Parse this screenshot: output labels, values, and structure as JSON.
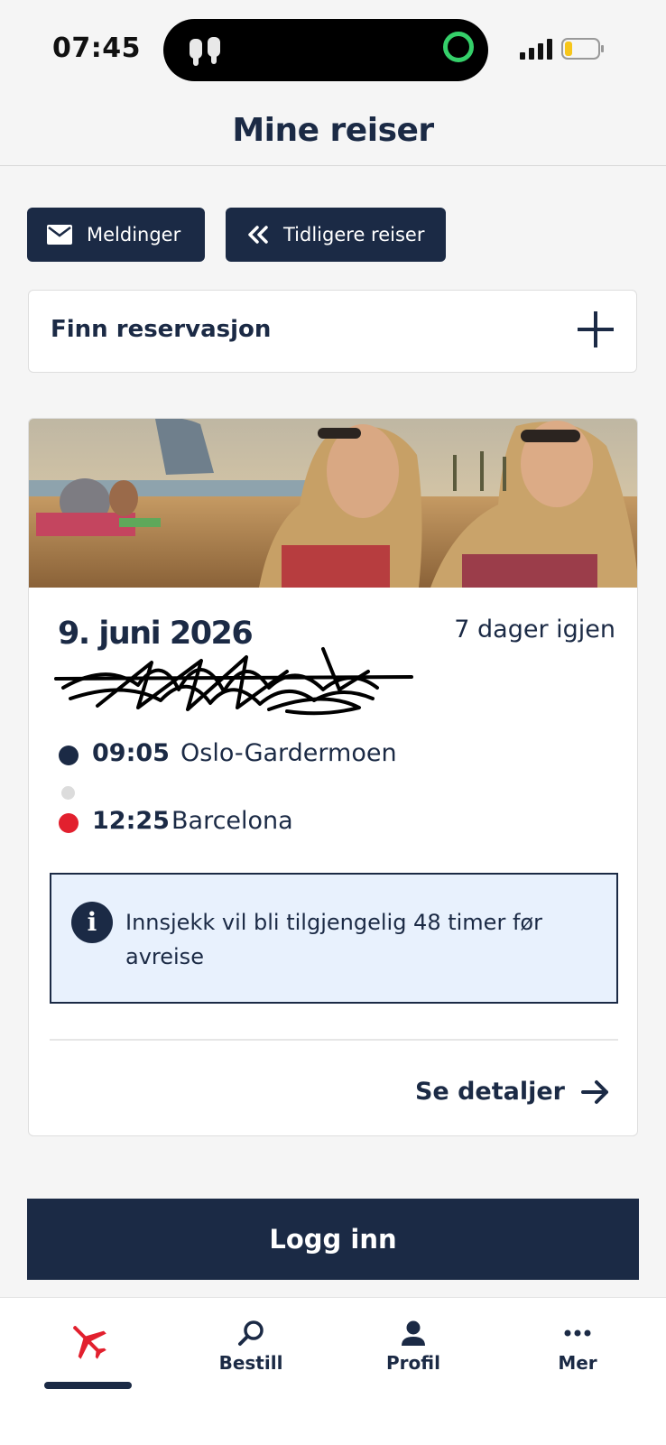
{
  "status_bar": {
    "time": "07:45"
  },
  "header": {
    "title": "Mine reiser"
  },
  "actions": {
    "messages_label": "Meldinger",
    "previous_trips_label": "Tidligere reiser"
  },
  "find_reservation": {
    "label": "Finn reservasjon"
  },
  "trip": {
    "date": "9. juni 2026",
    "days_left": "7 dager igjen",
    "departure": {
      "time": "09:05",
      "place": "Oslo-Gardermoen"
    },
    "arrival": {
      "time": "12:25",
      "place": "Barcelona"
    },
    "checkin_info": "Innsjekk vil bli tilgjengelig 48 timer før avreise",
    "details_label": "Se detaljer"
  },
  "login": {
    "label": "Logg inn"
  },
  "bottom_nav": {
    "items": [
      {
        "label": "",
        "icon": "airplane-icon",
        "active": true
      },
      {
        "label": "Bestill",
        "icon": "search-icon"
      },
      {
        "label": "Profil",
        "icon": "person-icon"
      },
      {
        "label": "Mer",
        "icon": "more-icon"
      }
    ]
  },
  "colors": {
    "brand_navy": "#1b2a45",
    "accent_red": "#e2202e",
    "info_bg": "#e8f1fd"
  }
}
